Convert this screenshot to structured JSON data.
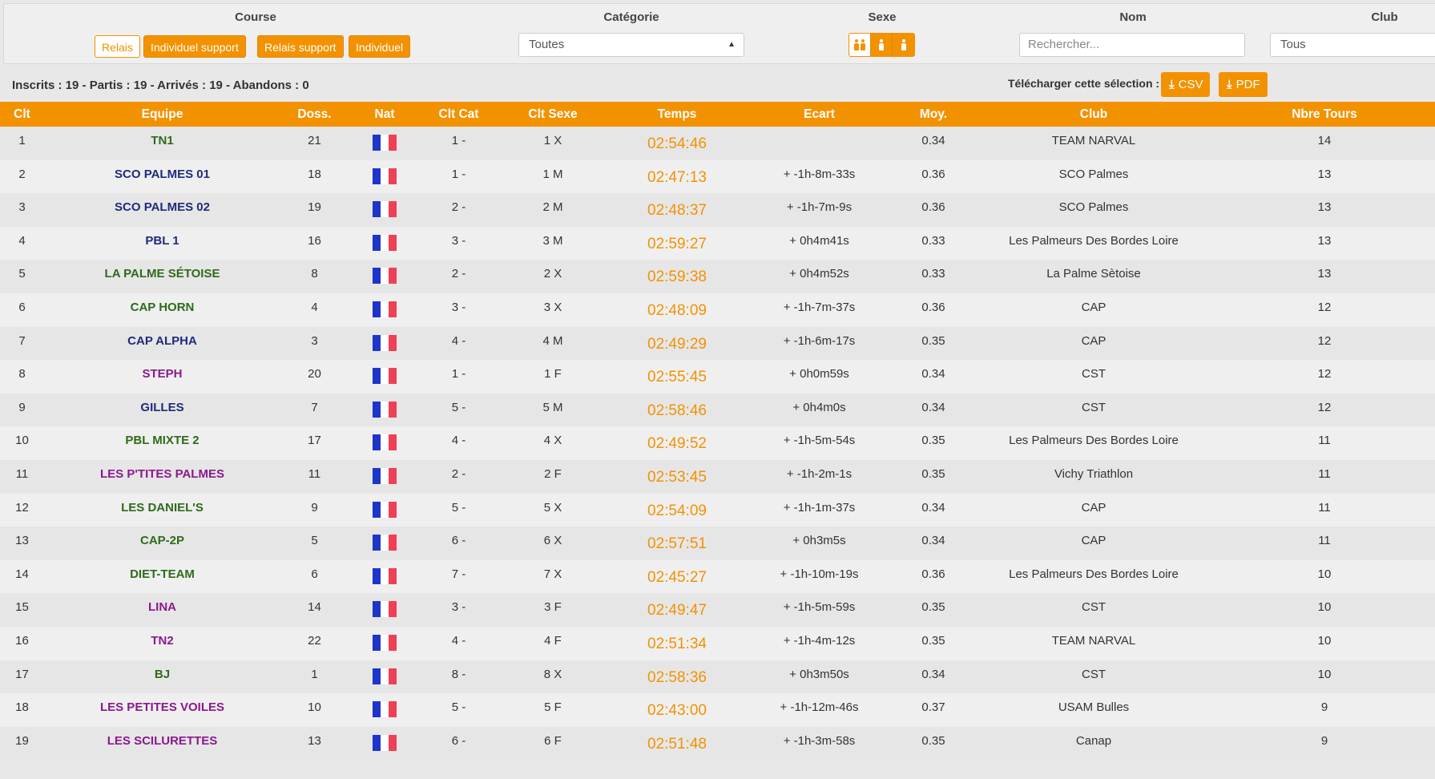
{
  "colors": {
    "accent": "#f39200",
    "team_blue": "#1f2b7b",
    "team_green": "#2e6b1a",
    "team_purple": "#8a1a8c",
    "flag_blue": "#1d35c9",
    "flag_white": "#ffffff",
    "flag_red": "#ef4056"
  },
  "filters": {
    "course": {
      "label": "Course",
      "options": [
        "Relais",
        "Individuel support",
        "Relais support",
        "Individuel"
      ],
      "selected": "Relais"
    },
    "categorie": {
      "label": "Catégorie",
      "value": "Toutes"
    },
    "sexe": {
      "label": "Sexe",
      "options": [
        "mixed-icon",
        "male-icon",
        "female-icon"
      ],
      "selected": "mixed-icon"
    },
    "nom": {
      "label": "Nom",
      "placeholder": "Rechercher..."
    },
    "club": {
      "label": "Club",
      "value": "Tous"
    }
  },
  "stats": "Inscrits : 19 - Partis : 19 - Arrivés : 19 - Abandons : 0",
  "download": {
    "label": "Télécharger cette sélection :",
    "csv": "CSV",
    "pdf": "PDF"
  },
  "table": {
    "headers": [
      "Clt",
      "Equipe",
      "Doss.",
      "Nat",
      "Clt Cat",
      "Clt Sexe",
      "Temps",
      "Ecart",
      "Moy.",
      "Club",
      "Nbre Tours"
    ],
    "rows": [
      {
        "clt": "1",
        "equipe": "TN1",
        "sexe": "X",
        "doss": "21",
        "cltcat": "1 -",
        "cltsexe": "1 X",
        "temps": "02:54:46",
        "ecart": "",
        "moy": "0.34",
        "club": "TEAM NARVAL",
        "tours": "14"
      },
      {
        "clt": "2",
        "equipe": "SCO PALMES 01",
        "sexe": "M",
        "doss": "18",
        "cltcat": "1 -",
        "cltsexe": "1 M",
        "temps": "02:47:13",
        "ecart": "+ -1h-8m-33s",
        "moy": "0.36",
        "club": "SCO Palmes",
        "tours": "13"
      },
      {
        "clt": "3",
        "equipe": "SCO PALMES 02",
        "sexe": "M",
        "doss": "19",
        "cltcat": "2 -",
        "cltsexe": "2 M",
        "temps": "02:48:37",
        "ecart": "+ -1h-7m-9s",
        "moy": "0.36",
        "club": "SCO Palmes",
        "tours": "13"
      },
      {
        "clt": "4",
        "equipe": "PBL 1",
        "sexe": "M",
        "doss": "16",
        "cltcat": "3 -",
        "cltsexe": "3 M",
        "temps": "02:59:27",
        "ecart": "+ 0h4m41s",
        "moy": "0.33",
        "club": "Les Palmeurs Des Bordes Loire",
        "tours": "13"
      },
      {
        "clt": "5",
        "equipe": "LA PALME SÉTOISE",
        "sexe": "X",
        "doss": "8",
        "cltcat": "2 -",
        "cltsexe": "2 X",
        "temps": "02:59:38",
        "ecart": "+ 0h4m52s",
        "moy": "0.33",
        "club": "La Palme Sètoise",
        "tours": "13"
      },
      {
        "clt": "6",
        "equipe": "CAP HORN",
        "sexe": "X",
        "doss": "4",
        "cltcat": "3 -",
        "cltsexe": "3 X",
        "temps": "02:48:09",
        "ecart": "+ -1h-7m-37s",
        "moy": "0.36",
        "club": "CAP",
        "tours": "12"
      },
      {
        "clt": "7",
        "equipe": "CAP ALPHA",
        "sexe": "M",
        "doss": "3",
        "cltcat": "4 -",
        "cltsexe": "4 M",
        "temps": "02:49:29",
        "ecart": "+ -1h-6m-17s",
        "moy": "0.35",
        "club": "CAP",
        "tours": "12"
      },
      {
        "clt": "8",
        "equipe": "STEPH",
        "sexe": "F",
        "doss": "20",
        "cltcat": "1 -",
        "cltsexe": "1 F",
        "temps": "02:55:45",
        "ecart": "+ 0h0m59s",
        "moy": "0.34",
        "club": "CST",
        "tours": "12"
      },
      {
        "clt": "9",
        "equipe": "GILLES",
        "sexe": "M",
        "doss": "7",
        "cltcat": "5 -",
        "cltsexe": "5 M",
        "temps": "02:58:46",
        "ecart": "+ 0h4m0s",
        "moy": "0.34",
        "club": "CST",
        "tours": "12"
      },
      {
        "clt": "10",
        "equipe": "PBL MIXTE 2",
        "sexe": "X",
        "doss": "17",
        "cltcat": "4 -",
        "cltsexe": "4 X",
        "temps": "02:49:52",
        "ecart": "+ -1h-5m-54s",
        "moy": "0.35",
        "club": "Les Palmeurs Des Bordes Loire",
        "tours": "11"
      },
      {
        "clt": "11",
        "equipe": "LES P'TITES PALMES",
        "sexe": "F",
        "doss": "11",
        "cltcat": "2 -",
        "cltsexe": "2 F",
        "temps": "02:53:45",
        "ecart": "+ -1h-2m-1s",
        "moy": "0.35",
        "club": "Vichy Triathlon",
        "tours": "11"
      },
      {
        "clt": "12",
        "equipe": "LES DANIEL'S",
        "sexe": "X",
        "doss": "9",
        "cltcat": "5 -",
        "cltsexe": "5 X",
        "temps": "02:54:09",
        "ecart": "+ -1h-1m-37s",
        "moy": "0.34",
        "club": "CAP",
        "tours": "11"
      },
      {
        "clt": "13",
        "equipe": "CAP-2P",
        "sexe": "X",
        "doss": "5",
        "cltcat": "6 -",
        "cltsexe": "6 X",
        "temps": "02:57:51",
        "ecart": "+ 0h3m5s",
        "moy": "0.34",
        "club": "CAP",
        "tours": "11"
      },
      {
        "clt": "14",
        "equipe": "DIET-TEAM",
        "sexe": "X",
        "doss": "6",
        "cltcat": "7 -",
        "cltsexe": "7 X",
        "temps": "02:45:27",
        "ecart": "+ -1h-10m-19s",
        "moy": "0.36",
        "club": "Les Palmeurs Des Bordes Loire",
        "tours": "10"
      },
      {
        "clt": "15",
        "equipe": "LINA",
        "sexe": "F",
        "doss": "14",
        "cltcat": "3 -",
        "cltsexe": "3 F",
        "temps": "02:49:47",
        "ecart": "+ -1h-5m-59s",
        "moy": "0.35",
        "club": "CST",
        "tours": "10"
      },
      {
        "clt": "16",
        "equipe": "TN2",
        "sexe": "F",
        "doss": "22",
        "cltcat": "4 -",
        "cltsexe": "4 F",
        "temps": "02:51:34",
        "ecart": "+ -1h-4m-12s",
        "moy": "0.35",
        "club": "TEAM NARVAL",
        "tours": "10"
      },
      {
        "clt": "17",
        "equipe": "BJ",
        "sexe": "X",
        "doss": "1",
        "cltcat": "8 -",
        "cltsexe": "8 X",
        "temps": "02:58:36",
        "ecart": "+ 0h3m50s",
        "moy": "0.34",
        "club": "CST",
        "tours": "10"
      },
      {
        "clt": "18",
        "equipe": "LES PETITES VOILES",
        "sexe": "F",
        "doss": "10",
        "cltcat": "5 -",
        "cltsexe": "5 F",
        "temps": "02:43:00",
        "ecart": "+ -1h-12m-46s",
        "moy": "0.37",
        "club": "USAM Bulles",
        "tours": "9"
      },
      {
        "clt": "19",
        "equipe": "LES SCILURETTES",
        "sexe": "F",
        "doss": "13",
        "cltcat": "6 -",
        "cltsexe": "6 F",
        "temps": "02:51:48",
        "ecart": "+ -1h-3m-58s",
        "moy": "0.35",
        "club": "Canap",
        "tours": "9"
      }
    ]
  }
}
